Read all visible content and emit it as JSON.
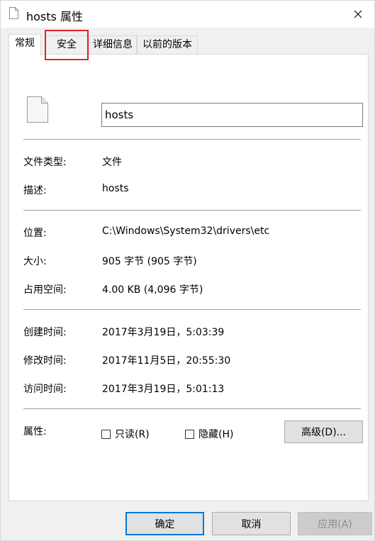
{
  "window": {
    "title": "hosts 属性"
  },
  "tabs": [
    {
      "label": "常规",
      "active": true
    },
    {
      "label": "安全",
      "active": false
    },
    {
      "label": "详细信息",
      "active": false
    },
    {
      "label": "以前的版本",
      "active": false
    }
  ],
  "general": {
    "file_name": "hosts",
    "rows": {
      "type": {
        "label": "文件类型:",
        "value": "文件"
      },
      "description": {
        "label": "描述:",
        "value": "hosts"
      },
      "location": {
        "label": "位置:",
        "value": "C:\\Windows\\System32\\drivers\\etc"
      },
      "size": {
        "label": "大小:",
        "value": "905 字节 (905 字节)"
      },
      "size_on_disk": {
        "label": "占用空间:",
        "value": "4.00 KB (4,096 字节)"
      },
      "created": {
        "label": "创建时间:",
        "value": "2017年3月19日，5:03:39"
      },
      "modified": {
        "label": "修改时间:",
        "value": "2017年11月5日，20:55:30"
      },
      "accessed": {
        "label": "访问时间:",
        "value": "2017年3月19日，5:01:13"
      }
    },
    "attributes": {
      "label": "属性:",
      "readonly": {
        "label": "只读(R)",
        "checked": false
      },
      "hidden": {
        "label": "隐藏(H)",
        "checked": false
      },
      "advanced_label": "高级(D)..."
    }
  },
  "footer": {
    "ok_label": "确定",
    "cancel_label": "取消",
    "apply_label": "应用(A)"
  },
  "colors": {
    "highlight": "#e6212a",
    "default_button_border": "#0078d7"
  },
  "icons": {
    "title": "file-icon",
    "close": "close-icon",
    "file": "file-icon"
  }
}
